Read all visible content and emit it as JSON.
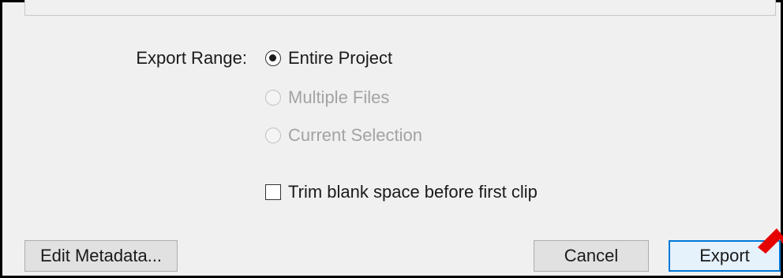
{
  "export_range": {
    "label": "Export Range:",
    "options": [
      {
        "label": "Entire Project",
        "selected": true,
        "enabled": true
      },
      {
        "label": "Multiple Files",
        "selected": false,
        "enabled": false
      },
      {
        "label": "Current Selection",
        "selected": false,
        "enabled": false
      }
    ]
  },
  "trim_option": {
    "label": "Trim blank space before first clip",
    "checked": false
  },
  "buttons": {
    "edit_metadata": "Edit Metadata...",
    "cancel": "Cancel",
    "export": "Export"
  },
  "colors": {
    "dialog_background": "#f0f0f0",
    "default_button_border": "#0078d7",
    "disabled_text": "#a3a3a3",
    "annotation_arrow": "#e60000"
  },
  "icons": {
    "annotation": "red-arrow-icon"
  }
}
